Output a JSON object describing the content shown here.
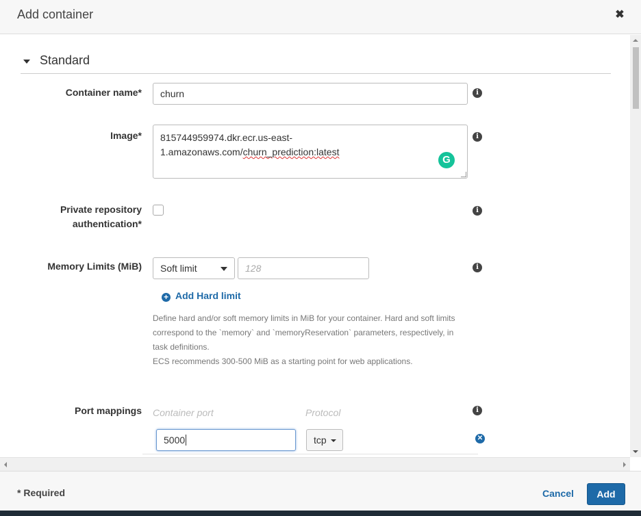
{
  "modal": {
    "title": "Add container",
    "close_glyph": "✖"
  },
  "section": {
    "title": "Standard"
  },
  "fields": {
    "container_name": {
      "label": "Container name*",
      "value": "churn"
    },
    "image": {
      "label": "Image*",
      "value_line1": "815744959974.dkr.ecr.us-east-",
      "value_line2_prefix": "1.amazonaws.com/",
      "value_line2_suffix": "churn_prediction:latest"
    },
    "private_repo": {
      "label_line1": "Private repository",
      "label_line2": "authentication*",
      "checked": false
    },
    "memory": {
      "label": "Memory Limits (MiB)",
      "limit_type": "Soft limit",
      "placeholder": "128",
      "add_hard_limit": "Add Hard limit",
      "help_lines": [
        "Define hard and/or soft memory limits in MiB for your container. Hard and soft limits",
        "correspond to the `memory` and `memoryReservation` parameters, respectively, in",
        "task definitions.",
        "ECS recommends 300-500 MiB as a starting point for web applications."
      ]
    },
    "port_mappings": {
      "label": "Port mappings",
      "col_container_port": "Container port",
      "col_protocol": "Protocol",
      "container_port_value": "5000",
      "protocol_value": "tcp"
    }
  },
  "icons": {
    "info": "info-icon",
    "grammarly": "grammarly-icon",
    "plus": "plus-circle-icon",
    "remove": "remove-circle-icon"
  },
  "footer": {
    "required_note": "* Required",
    "cancel_label": "Cancel",
    "add_label": "Add"
  },
  "colors": {
    "accent": "#1e6aa8",
    "grammarly": "#15c39a"
  }
}
